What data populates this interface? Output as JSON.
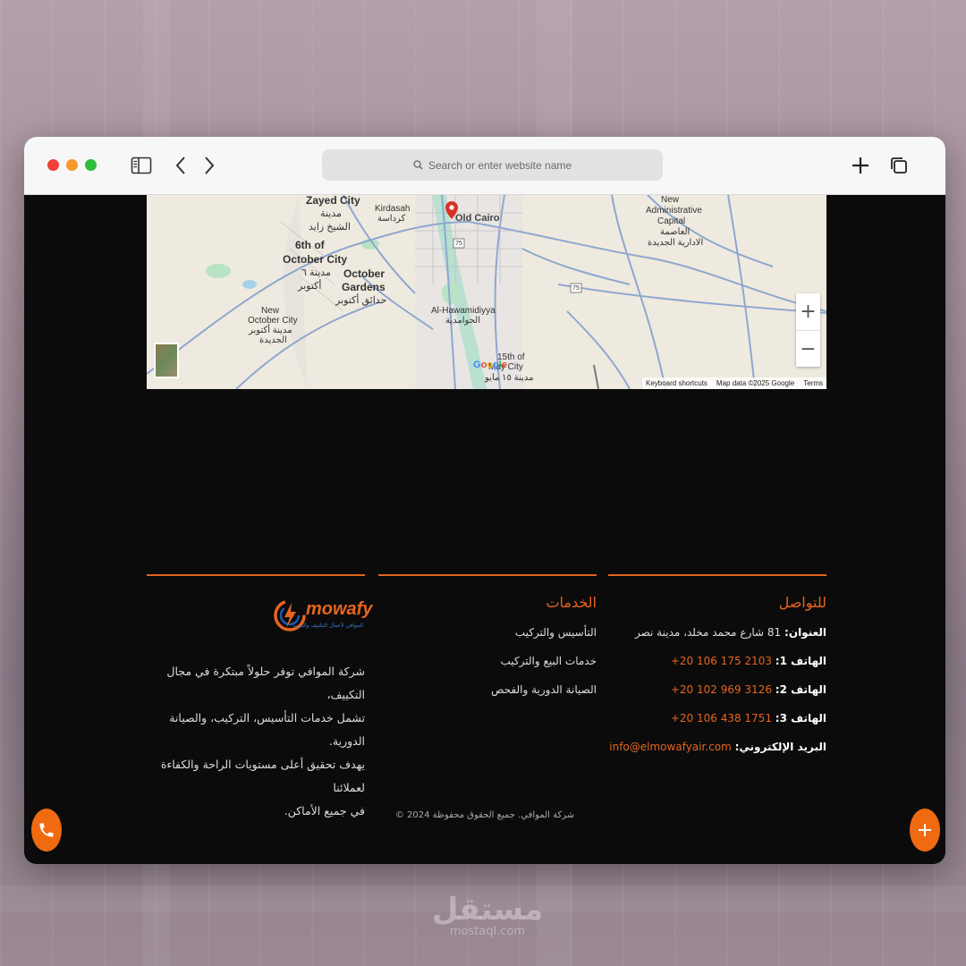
{
  "browser": {
    "address_placeholder": "Search or enter website name"
  },
  "map": {
    "labels": [
      {
        "text": "Zayed City"
      },
      {
        "text": "مدينة"
      },
      {
        "text": "الشيخ زايد"
      },
      {
        "text": "Kirdasah"
      },
      {
        "text": "كرداسة"
      },
      {
        "text": "Old Cairo"
      },
      {
        "text": "6th of"
      },
      {
        "text": "October City"
      },
      {
        "text": "مدينة ٦"
      },
      {
        "text": "أكتوبر"
      },
      {
        "text": "October"
      },
      {
        "text": "Gardens"
      },
      {
        "text": "حدائق أكتوبر"
      },
      {
        "text": "New"
      },
      {
        "text": "October City"
      },
      {
        "text": "مدينة أكتوبر"
      },
      {
        "text": "الجديدة"
      },
      {
        "text": "Al-Hawamidiyya"
      },
      {
        "text": "الحوامدية"
      },
      {
        "text": "15th of"
      },
      {
        "text": "May City"
      },
      {
        "text": "مدينة ١٥ مايو"
      },
      {
        "text": "New"
      },
      {
        "text": "Administrative"
      },
      {
        "text": "Capital"
      },
      {
        "text": "العاصمة"
      },
      {
        "text": "الادارية الجديدة"
      }
    ],
    "road_shields": [
      "75",
      "75"
    ],
    "zoom_in": "+",
    "zoom_out": "−",
    "google": "Google",
    "footer": {
      "shortcuts": "Keyboard shortcuts",
      "map_data": "Map data ©2025 Google",
      "terms": "Terms"
    }
  },
  "contact": {
    "title": "للتواصل",
    "address_label": "العنوان:",
    "address_value": "81 شارع محمد مخلد، مدينة نصر",
    "phone1_label": "الهاتف 1:",
    "phone1_value": "+20 106 175 2103",
    "phone2_label": "الهاتف 2:",
    "phone2_value": "+20 102 969 3126",
    "phone3_label": "الهاتف 3:",
    "phone3_value": "+20 106 438 1751",
    "email_label": "البريد الإلكتروني:",
    "email_value": "info@elmowafyair.com"
  },
  "services": {
    "title": "الخدمات",
    "items": [
      "التأسيس والتركيب",
      "خدمات البيع والتركيب",
      "الصيانة الدورية والفحص"
    ]
  },
  "about": {
    "logo_text": "mowafy",
    "logo_tagline": "الموافي لأعمال التكييف والتبريد",
    "line1": "شركة الموافي توفر حلولاً مبتكرة في مجال التكييف،",
    "line2": "تشمل خدمات التأسيس، التركيب، والصيانة الدورية.",
    "line3": "يهدف تحقيق أعلى مستويات الراحة والكفاءة لعملائنا",
    "line4": "في جميع الأماكن."
  },
  "footer": {
    "copyright": "شركة الموافي. جميع الحقوق محفوظة 2024 ©"
  },
  "watermark": {
    "arabic": "مستقل",
    "latin": "mostaql.com"
  },
  "colors": {
    "accent": "#e8641c",
    "page_bg": "#0b0b0b"
  }
}
